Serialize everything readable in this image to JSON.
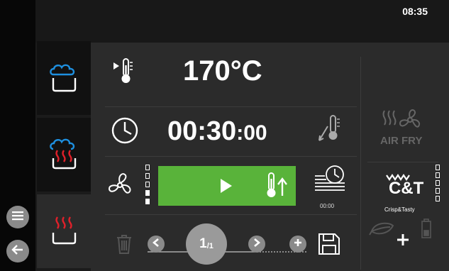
{
  "status": {
    "time": "08:35"
  },
  "parameters": {
    "temperature": "170°C",
    "time_main": "00:30",
    "time_seconds": ":00",
    "timer_preset": "00:00"
  },
  "pager": {
    "current": "1",
    "total": "/1"
  },
  "side_functions": {
    "air_fry_label": "AIR FRY",
    "crisp_tasty_logo": "C&T",
    "crisp_tasty_label": "Crisp&Tasty"
  },
  "fan_speed": {
    "level": 2,
    "steps": 5
  },
  "crisp_level": {
    "level": 0,
    "steps": 5
  },
  "colors": {
    "start_green": "#59b33a",
    "steam_blue": "#1e90e0",
    "heat_red": "#e0202a",
    "panel": "#2b2b2b"
  },
  "icons": {
    "menu": "menu-icon",
    "back": "back-arrow-icon",
    "steam": "steam-cloud-icon",
    "combi": "combi-steam-heat-icon",
    "convection": "convection-heat-icon",
    "core_probe": "core-temperature-icon",
    "clock": "clock-icon",
    "probe_switch": "probe-switch-icon",
    "fan": "fan-icon",
    "play": "play-icon",
    "probe_up": "temperature-up-icon",
    "timer_preset": "timer-preset-icon",
    "trash": "trash-icon",
    "save": "save-icon",
    "eco": "leaf-icon",
    "battery": "battery-icon"
  }
}
